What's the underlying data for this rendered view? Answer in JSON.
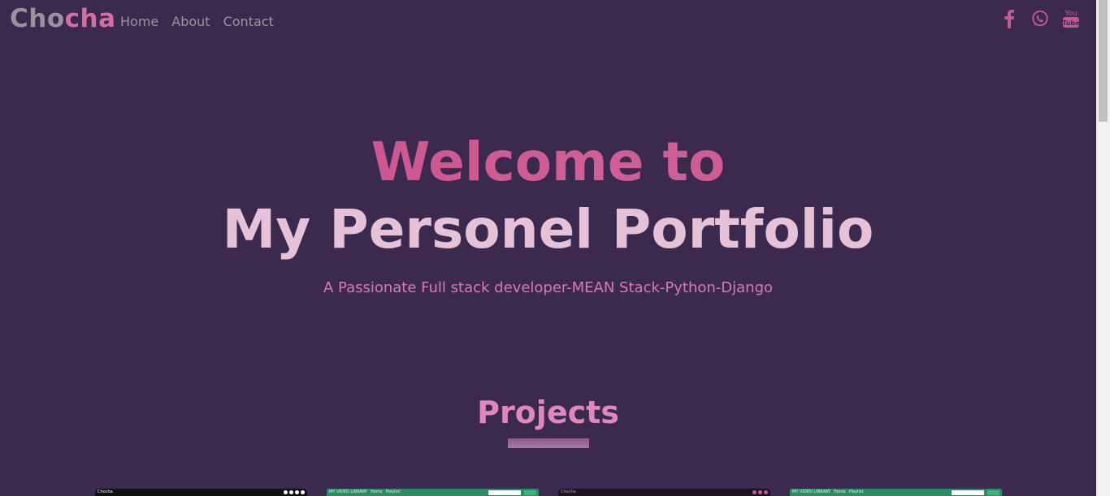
{
  "navbar": {
    "brand_part1": "Cho",
    "brand_part2": "cha",
    "links": [
      "Home",
      "About",
      "Contact"
    ],
    "social_icons": [
      "facebook-icon",
      "whatsapp-icon",
      "youtube-icon"
    ],
    "accent_color": "#c45a93"
  },
  "hero": {
    "line1": "Welcome to",
    "line2": "My Personel Portfolio",
    "subtitle": "A Passionate Full stack developer-MEAN Stack-Python-Django"
  },
  "projects": {
    "title": "Projects",
    "thumbnails": [
      {
        "label": "Chocha"
      },
      {
        "label": "MY VIDEO LIBRARY",
        "nav": [
          "Home",
          "Playlist"
        ],
        "search": "Search"
      },
      {
        "label": "Chocha"
      },
      {
        "label": "MY VIDEO LIBRARY",
        "nav": [
          "Home",
          "Playlist"
        ],
        "search": "Search"
      }
    ]
  },
  "colors": {
    "background": "#3b2a4e",
    "pink": "#d05f97",
    "light_pink": "#e6c2d8"
  }
}
